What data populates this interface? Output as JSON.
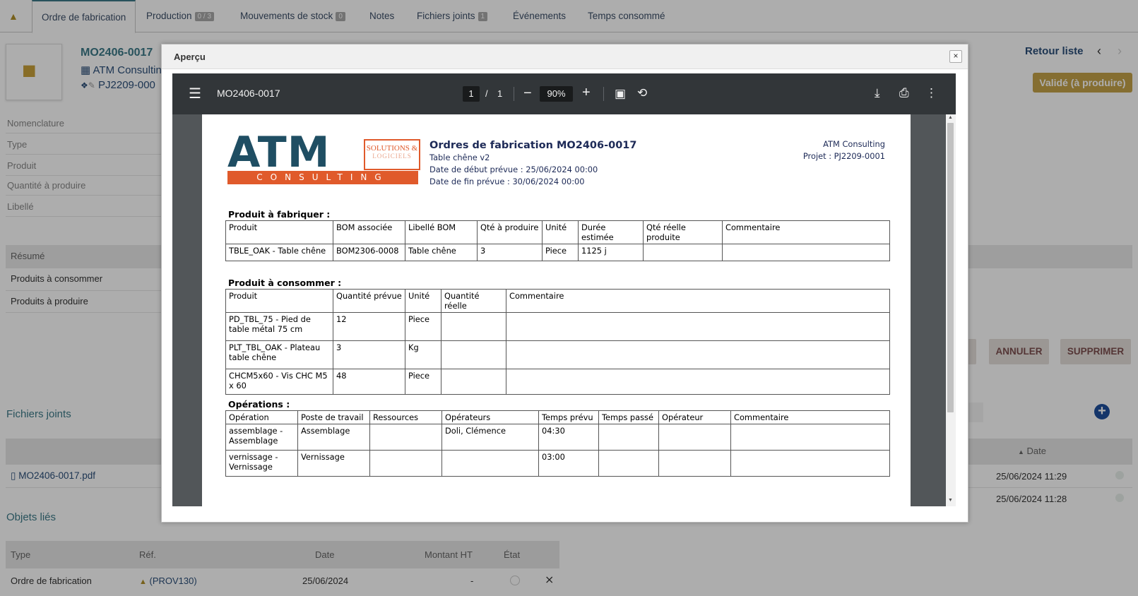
{
  "tabs": [
    {
      "label": "Ordre de fabrication",
      "badge": ""
    },
    {
      "label": "Production",
      "badge": "0 / 3"
    },
    {
      "label": "Mouvements de stock",
      "badge": "0"
    },
    {
      "label": "Notes",
      "badge": ""
    },
    {
      "label": "Fichiers joints",
      "badge": "1"
    },
    {
      "label": "Événements",
      "badge": ""
    },
    {
      "label": "Temps consommé",
      "badge": ""
    }
  ],
  "record": {
    "ref": "MO2406-0017",
    "thirdparty": "ATM Consulting",
    "project": "PJ2209-000"
  },
  "fields": [
    "Nomenclature",
    "Type",
    "Produit",
    "Quantité à produire",
    "Libellé"
  ],
  "summary_tabs": [
    "Résumé",
    "Produits à consommer",
    "Produits à produire"
  ],
  "nav": {
    "back": "Retour liste",
    "status": "Validé (à produire)"
  },
  "actions": {
    "cancel": "ANNULER",
    "delete": "SUPPRIMER"
  },
  "files": {
    "title": "Fichiers joints",
    "date_header": "Date",
    "file": "MO2406-0017.pdf",
    "dates": [
      "25/06/2024 11:29",
      "25/06/2024 11:28"
    ]
  },
  "linked": {
    "title": "Objets liés",
    "headers": [
      "Type",
      "Réf.",
      "Date",
      "Montant HT",
      "État"
    ],
    "row": {
      "type": "Ordre de fabrication",
      "ref": "(PROV130)",
      "date": "25/06/2024",
      "amount": "-"
    }
  },
  "dialog": {
    "title": "Aperçu",
    "close": "×"
  },
  "viewer": {
    "filename": "MO2406-0017",
    "page_current": "1",
    "page_sep": "/",
    "page_total": "1",
    "zoom": "90%"
  },
  "pdf": {
    "logo": {
      "big": "ATM",
      "sub": "CONSULTING",
      "tag1": "SOLUTIONS &",
      "tag2": "LOGICIELS"
    },
    "title": "Ordres de fabrication MO2406-0017",
    "subtitle": "Table chêne v2",
    "start": "Date de début prévue : 25/06/2024 00:00",
    "end": "Date de fin prévue : 30/06/2024 00:00",
    "company": "ATM Consulting",
    "project": "Projet : PJ2209-0001",
    "produce": {
      "title": "Produit à fabriquer :",
      "headers": [
        "Produit",
        "BOM associée",
        "Libellé BOM",
        "Qté à produire",
        "Unité",
        "Durée estimée",
        "Qté réelle produite",
        "Commentaire"
      ],
      "rows": [
        [
          "TBLE_OAK - Table chêne",
          "BOM2306-0008",
          "Table chêne",
          "3",
          "Piece",
          "1125 j",
          "",
          ""
        ]
      ]
    },
    "consume": {
      "title": "Produit à consommer :",
      "headers": [
        "Produit",
        "Quantité prévue",
        "Unité",
        "Quantité réelle",
        "Commentaire"
      ],
      "rows": [
        [
          "PD_TBL_75 - Pied de table métal 75 cm",
          "12",
          "Piece",
          "",
          ""
        ],
        [
          "PLT_TBL_OAK - Plateau table chêne",
          "3",
          "Kg",
          "",
          ""
        ],
        [
          "CHCM5x60 - Vis CHC M5 x 60",
          "48",
          "Piece",
          "",
          ""
        ]
      ]
    },
    "ops": {
      "title": "Opérations :",
      "headers": [
        "Opération",
        "Poste de travail",
        "Ressources",
        "Opérateurs",
        "Temps prévu",
        "Temps passé",
        "Opérateur",
        "Commentaire"
      ],
      "rows": [
        [
          "assemblage - Assemblage",
          "Assemblage",
          "",
          "Doli, Clémence",
          "04:30",
          "",
          "",
          ""
        ],
        [
          "vernissage - Vernissage",
          "Vernissage",
          "",
          "",
          "03:00",
          "",
          "",
          ""
        ]
      ]
    }
  },
  "colors": {
    "accent": "#3c7a88",
    "status": "#c5a249",
    "overlay": "rgba(0,0,0,0.32)",
    "toolbar": "#323639",
    "logo_blue": "#1f4e63",
    "logo_orange": "#e05a2b"
  }
}
